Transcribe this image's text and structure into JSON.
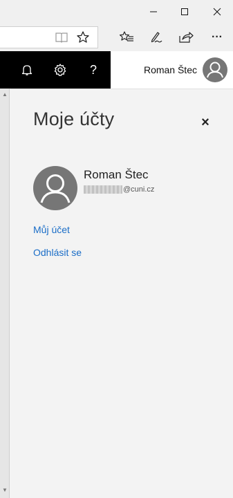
{
  "window": {
    "minimize_glyph": "—",
    "maximize_glyph": "☐",
    "close_glyph": "✕"
  },
  "toolbar": {
    "icons": [
      "reading-view-icon",
      "favorite-star-icon",
      "favorites-hub-icon",
      "pen-notes-icon",
      "share-icon",
      "more-icon"
    ],
    "more_glyph": "···"
  },
  "appbar": {
    "help_glyph": "?",
    "user_name": "Roman Štec"
  },
  "panel": {
    "title": "Moje účty",
    "close_glyph": "×",
    "account": {
      "name": "Roman Štec",
      "email_domain": "@cuni.cz"
    },
    "links": {
      "my_account": "Můj účet",
      "sign_out": "Odhlásit se"
    }
  },
  "colors": {
    "link": "#1a6dc7",
    "appbar_dark": "#000000",
    "avatar_bg": "#767676",
    "panel_bg": "#f3f3f3"
  }
}
